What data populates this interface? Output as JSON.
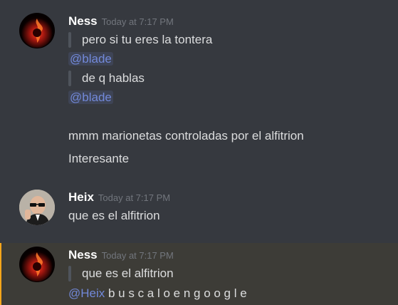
{
  "messages": [
    {
      "username": "Ness",
      "timestamp": "Today at 7:17 PM",
      "quote1": "pero si tu eres la tontera",
      "mention1": "@blade",
      "quote2": "de q hablas",
      "mention2": "@blade",
      "line1": "mmm marionetas controladas por el alfitrion",
      "line2": "Interesante"
    },
    {
      "username": "Heix",
      "timestamp": "Today at 7:17 PM",
      "line1": "que es el alfitrion"
    },
    {
      "username": "Ness",
      "timestamp": "Today at 7:17 PM",
      "quote1": "que es el alfitrion",
      "mention": "@Heix",
      "reply": "b u s c a l o e n g o o g l e"
    }
  ],
  "colors": {
    "background": "#36393f",
    "highlight_bg": "#3d3c37",
    "highlight_bar": "#faa61a",
    "mention": "#7289da",
    "username": "#ffffff",
    "timestamp": "#72767d",
    "text": "#dcddde"
  }
}
